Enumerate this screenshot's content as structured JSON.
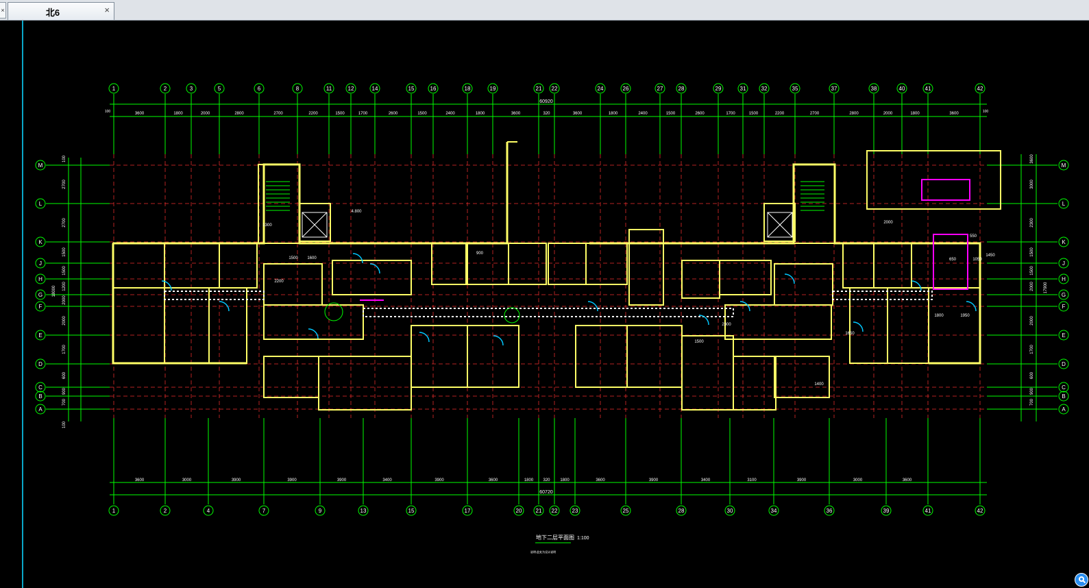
{
  "app": {
    "tab_left_stub": "×",
    "active_tab": {
      "title": "北6",
      "close_label": "×"
    }
  },
  "drawing": {
    "title": "地下二层平面图",
    "scale": "1:100",
    "note": "说明:此处为设计说明",
    "colors": {
      "background": "#000000",
      "grid": "#00ff00",
      "axis": "#ff3030",
      "wall": "#ffff66",
      "text": "#ffffff",
      "accent": "#ff00ff"
    },
    "top_axes": [
      "1",
      "2",
      "3",
      "5",
      "6",
      "8",
      "11",
      "12",
      "14",
      "15",
      "16",
      "18",
      "19",
      "21",
      "22",
      "24",
      "26",
      "27",
      "28",
      "29",
      "31",
      "32",
      "35",
      "37",
      "38",
      "40",
      "41",
      "42"
    ],
    "bottom_axes": [
      "1",
      "2",
      "4",
      "7",
      "9",
      "13",
      "15",
      "17",
      "20",
      "21",
      "22",
      "23",
      "25",
      "28",
      "30",
      "34",
      "36",
      "39",
      "41",
      "42"
    ],
    "left_axes": [
      "M",
      "L",
      "K",
      "J",
      "H",
      "G",
      "F",
      "E",
      "D",
      "C",
      "B",
      "A"
    ],
    "right_axes": [
      "M",
      "L",
      "K",
      "J",
      "H",
      "G",
      "F",
      "E",
      "D",
      "C",
      "B",
      "A"
    ],
    "top_total_dim": "60920",
    "bottom_total_dim": "60720",
    "top_dims": [
      "3600",
      "1800",
      "2000",
      "2800",
      "2700",
      "2200",
      "1500",
      "1700",
      "2600",
      "1500",
      "2400",
      "1800",
      "3600",
      "320",
      "3600",
      "1800",
      "2400",
      "1500",
      "2600",
      "1700",
      "1500",
      "2200",
      "2700",
      "2800",
      "2000",
      "1800",
      "3600"
    ],
    "top_end_dims": [
      "100",
      "100"
    ],
    "bottom_dims": [
      "3600",
      "3000",
      "3900",
      "3900",
      "3900",
      "3400",
      "3900",
      "3600",
      "1800",
      "320",
      "1800",
      "3600",
      "3900",
      "3400",
      "3100",
      "3900",
      "3000",
      "3600"
    ],
    "left_dims": [
      "100",
      "2700",
      "2700",
      "1500",
      "1500",
      "1200",
      "2000",
      "2000",
      "1700",
      "600",
      "900",
      "700",
      "100"
    ],
    "left_total": "18000",
    "right_dims": [
      "3600",
      "3000",
      "2300",
      "1500",
      "1500",
      "2000",
      "2000",
      "1700",
      "600",
      "900",
      "700"
    ],
    "right_total": "17900",
    "room_notes": [
      "1300",
      "4.800",
      "1500",
      "2200",
      "1600",
      "1500",
      "2300",
      "1800",
      "1950",
      "1650",
      "1400",
      "900",
      "650",
      "1050",
      "1450",
      "2000",
      "550"
    ]
  }
}
